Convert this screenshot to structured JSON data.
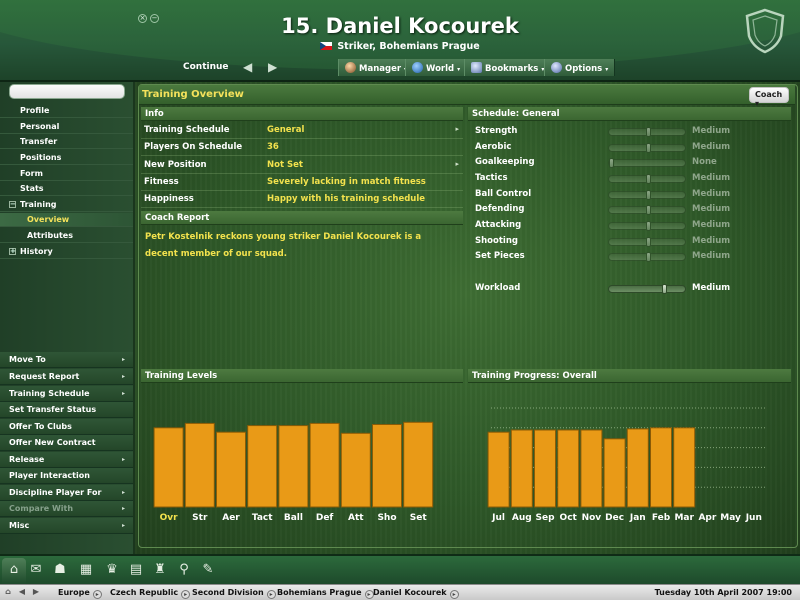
{
  "window": {
    "close_label": "×",
    "min_label": "−"
  },
  "header": {
    "title": "15. Daniel Kocourek",
    "subtitle": "Striker, Bohemians Prague",
    "continue_label": "Continue",
    "back_label": "◀",
    "forward_label": "▶",
    "menus": [
      {
        "label": "Manager",
        "icon": "manager-icon"
      },
      {
        "label": "World",
        "icon": "globe-icon"
      },
      {
        "label": "Bookmarks",
        "icon": "bookmarks-icon"
      },
      {
        "label": "Options",
        "icon": "options-icon"
      }
    ],
    "menu_caret": "▾"
  },
  "sidebar": {
    "search": {
      "value": "",
      "placeholder": ""
    },
    "items": [
      {
        "label": "Profile",
        "level": 0
      },
      {
        "label": "Personal",
        "level": 0
      },
      {
        "label": "Transfer",
        "level": 0
      },
      {
        "label": "Positions",
        "level": 0
      },
      {
        "label": "Form",
        "level": 0
      },
      {
        "label": "Stats",
        "level": 0
      },
      {
        "label": "Training",
        "level": 0,
        "tree": "−"
      },
      {
        "label": "Overview",
        "level": 1,
        "active": true
      },
      {
        "label": "Attributes",
        "level": 1
      },
      {
        "label": "History",
        "level": 0,
        "tree": "+"
      }
    ],
    "actions": [
      {
        "label": "Move To",
        "arrow": true
      },
      {
        "label": "Request Report",
        "arrow": true
      },
      {
        "label": "Training Schedule",
        "arrow": true
      },
      {
        "label": "Set Transfer Status",
        "arrow": false
      },
      {
        "label": "Offer To Clubs",
        "arrow": false
      },
      {
        "label": "Offer New Contract",
        "arrow": false
      },
      {
        "label": "Release",
        "arrow": true
      },
      {
        "label": "Player Interaction",
        "arrow": false
      },
      {
        "label": "Discipline Player For",
        "arrow": true
      },
      {
        "label": "Compare With",
        "arrow": true,
        "disabled": true
      },
      {
        "label": "Misc",
        "arrow": true
      }
    ],
    "arrow_glyph": "▸"
  },
  "main": {
    "page_title": "Training Overview",
    "coach_button": "Coach ▾",
    "info": {
      "header": "Info",
      "rows": [
        {
          "label": "Training Schedule",
          "value": "General",
          "dropdown": true
        },
        {
          "label": "Players On Schedule",
          "value": "36",
          "dropdown": false
        },
        {
          "label": "New Position",
          "value": "Not Set",
          "dropdown": true
        },
        {
          "label": "Fitness",
          "value": "Severely lacking in match fitness",
          "dropdown": false
        },
        {
          "label": "Happiness",
          "value": "Happy with his training schedule",
          "dropdown": false
        }
      ],
      "dropdown_glyph": "▸"
    },
    "coach_report": {
      "header": "Coach Report",
      "text": "Petr Kostelnik reckons young striker Daniel Kocourek is a decent member of our squad."
    },
    "schedule": {
      "header": "Schedule: General",
      "rows": [
        {
          "label": "Strength",
          "level": "Medium",
          "fraction": 0.5
        },
        {
          "label": "Aerobic",
          "level": "Medium",
          "fraction": 0.5
        },
        {
          "label": "Goalkeeping",
          "level": "None",
          "fraction": 0.0
        },
        {
          "label": "Tactics",
          "level": "Medium",
          "fraction": 0.5
        },
        {
          "label": "Ball Control",
          "level": "Medium",
          "fraction": 0.5
        },
        {
          "label": "Defending",
          "level": "Medium",
          "fraction": 0.5
        },
        {
          "label": "Attacking",
          "level": "Medium",
          "fraction": 0.5
        },
        {
          "label": "Shooting",
          "level": "Medium",
          "fraction": 0.5
        },
        {
          "label": "Set Pieces",
          "level": "Medium",
          "fraction": 0.5
        }
      ],
      "workload": {
        "label": "Workload",
        "level": "Medium",
        "fraction": 0.72
      }
    },
    "levels_header": "Training Levels",
    "progress_header": "Training Progress: Overall"
  },
  "chart_data": [
    {
      "type": "bar",
      "title": "Training Levels",
      "categories": [
        "Ovr",
        "Str",
        "Aer",
        "Tact",
        "Ball",
        "Def",
        "Att",
        "Sho",
        "Set"
      ],
      "values": [
        72,
        76,
        68,
        74,
        74,
        76,
        67,
        75,
        77
      ],
      "ylim": [
        0,
        100
      ],
      "bar_color": "#e99a17",
      "highlight_label_color": "#f3e24d",
      "grid": false
    },
    {
      "type": "bar",
      "title": "Training Progress: Overall",
      "categories": [
        "Jul",
        "Aug",
        "Sep",
        "Oct",
        "Nov",
        "Dec",
        "Jan",
        "Feb",
        "Mar",
        "Apr",
        "May",
        "Jun"
      ],
      "values": [
        68,
        70,
        70,
        70,
        70,
        62,
        71,
        72,
        72,
        null,
        null,
        null
      ],
      "ylim": [
        0,
        100
      ],
      "bar_color": "#e99a17",
      "grid": true
    }
  ],
  "toolbar": {
    "icons": [
      "home-icon",
      "inbox-icon",
      "team-icon",
      "scout-icon",
      "trophy-icon",
      "news-icon",
      "tactics-icon",
      "search-icon",
      "notes-icon"
    ],
    "glyphs": [
      "⌂",
      "✉",
      "☗",
      "▦",
      "♛",
      "▤",
      "♜",
      "⚲",
      "✎"
    ]
  },
  "status": {
    "breadcrumbs": [
      "Europe",
      "Czech Republic",
      "Second Division",
      "Bohemians Prague",
      "Daniel Kocourek"
    ],
    "crumb_glyph": "▸",
    "date": "Tuesday 10th April 2007 19:00"
  },
  "colors": {
    "accent_yellow": "#f3e24d",
    "bar_orange": "#e99a17",
    "panel_green": "#3b6631"
  }
}
